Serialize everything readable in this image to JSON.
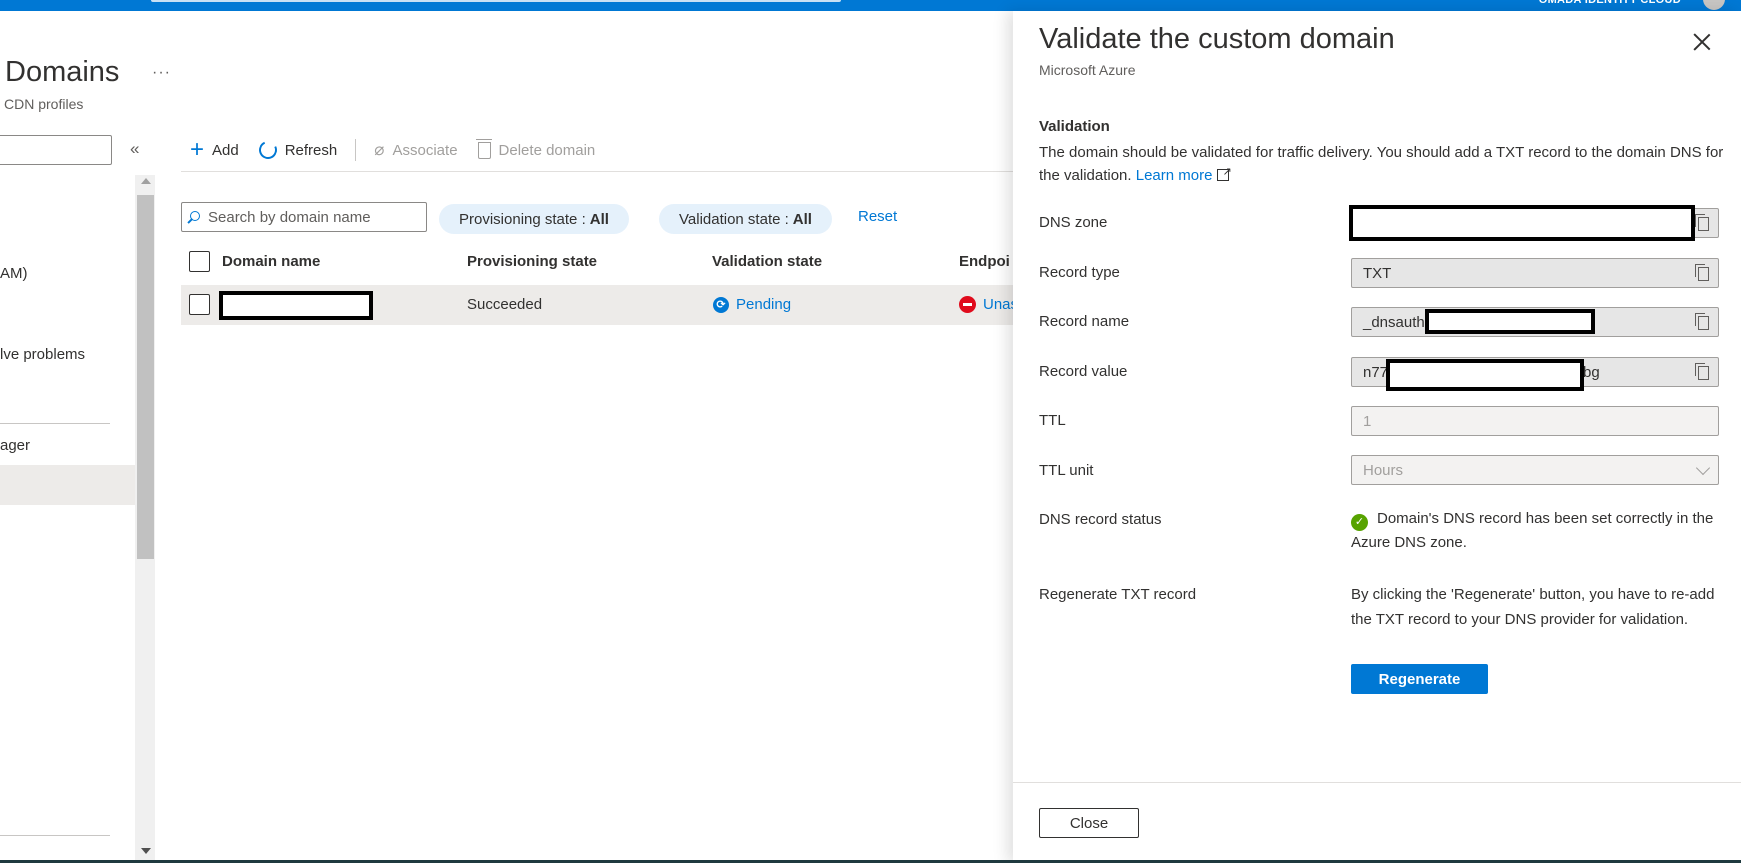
{
  "topbar": {
    "tenant": "OMADA IDENTITY CLOUD"
  },
  "page": {
    "title": "Domains",
    "more": "···",
    "subtitle": "CDN profiles"
  },
  "left_nav": {
    "collapse": "«",
    "items": [
      {
        "label": "AM)"
      },
      {
        "label": "lve problems"
      },
      {
        "label": "ager"
      }
    ]
  },
  "toolbar": {
    "add": "Add",
    "refresh": "Refresh",
    "associate": "Associate",
    "delete": "Delete domain"
  },
  "filters": {
    "search_placeholder": "Search by domain name",
    "provisioning_label": "Provisioning state :",
    "provisioning_value": "All",
    "validation_label": "Validation state :",
    "validation_value": "All",
    "reset": "Reset"
  },
  "table": {
    "columns": [
      "Domain name",
      "Provisioning state",
      "Validation state",
      "Endpoi"
    ],
    "rows": [
      {
        "domain": "",
        "provisioning": "Succeeded",
        "validation": "Pending",
        "endpoint": "Unas"
      }
    ]
  },
  "panel": {
    "title": "Validate the custom domain",
    "subtitle": "Microsoft Azure",
    "section_title": "Validation",
    "section_desc": "The domain should be validated for traffic delivery. You should add a TXT record to the domain DNS for the validation.",
    "learn_more": "Learn more",
    "fields": {
      "dns_zone": {
        "label": "DNS zone",
        "value": ""
      },
      "record_type": {
        "label": "Record type",
        "value": "TXT"
      },
      "record_name": {
        "label": "Record name",
        "value": "_dnsauth"
      },
      "record_value": {
        "label": "Record value",
        "value_prefix": "n77",
        "value_suffix": "bg"
      },
      "ttl": {
        "label": "TTL",
        "value": "1"
      },
      "ttl_unit": {
        "label": "TTL unit",
        "value": "Hours"
      },
      "dns_status": {
        "label": "DNS record status",
        "value": "Domain's DNS record has been set correctly in the Azure DNS zone."
      },
      "regenerate": {
        "label": "Regenerate TXT record",
        "desc": "By clicking the 'Regenerate' button, you have to re-add the TXT record to your DNS provider for validation."
      }
    },
    "regenerate_button": "Regenerate",
    "close_button": "Close"
  },
  "colors": {
    "accent": "#0078d4",
    "success": "#57a300",
    "error": "#e00b1c",
    "pill_bg": "#e5f1fb"
  }
}
